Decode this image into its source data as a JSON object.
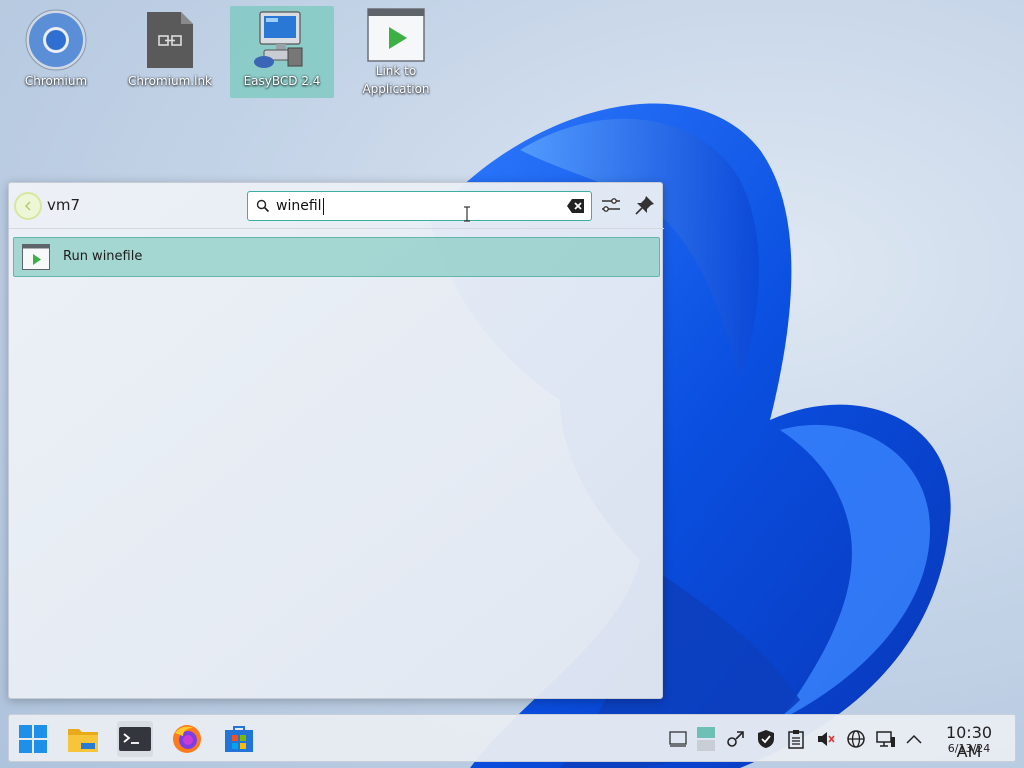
{
  "desktop": {
    "icons": [
      {
        "label": "Chromium"
      },
      {
        "label": "Chromium.lnk"
      },
      {
        "label": "EasyBCD 2.4"
      },
      {
        "label": "Link to Application"
      }
    ]
  },
  "launcher": {
    "username": "vm7",
    "search": {
      "value": "winefil"
    },
    "results": [
      {
        "label": "Run winefile"
      }
    ]
  },
  "taskbar": {
    "clock": {
      "time": "10:30 AM",
      "date": "6/13/24"
    }
  },
  "colors": {
    "accent": "#3daea0",
    "selection": "#8ccdc6",
    "wallpaper_blue": "#1a5fe0"
  }
}
